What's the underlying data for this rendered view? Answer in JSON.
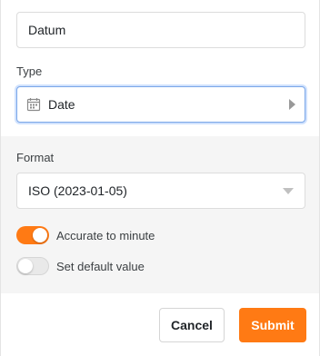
{
  "column_name": {
    "value": "Datum"
  },
  "type": {
    "label": "Type",
    "value": "Date",
    "icon": "calendar-icon"
  },
  "format": {
    "label": "Format",
    "value": "ISO (2023-01-05)"
  },
  "toggles": [
    {
      "label": "Accurate to minute",
      "on": true
    },
    {
      "label": "Set default value",
      "on": false
    }
  ],
  "footer": {
    "cancel_label": "Cancel",
    "submit_label": "Submit"
  },
  "colors": {
    "accent": "#ff7a14",
    "focus_border": "#7aa6e8",
    "section_bg": "#f5f5f5"
  }
}
